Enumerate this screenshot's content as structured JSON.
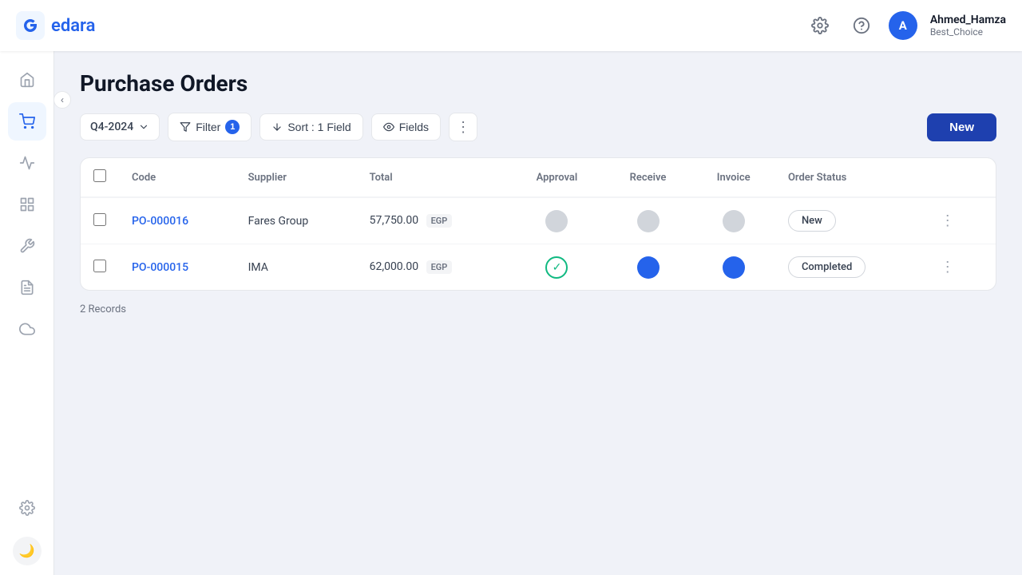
{
  "app": {
    "logo_text": "edara",
    "title": "Purchase Orders"
  },
  "header": {
    "settings_icon": "⚙",
    "help_icon": "?",
    "user_avatar_letter": "A",
    "user_name": "Ahmed_Hamza",
    "user_sub": "Best_Choice"
  },
  "sidebar": {
    "items": [
      {
        "id": "home",
        "icon": "⌂",
        "label": "Home",
        "active": false
      },
      {
        "id": "cart",
        "icon": "🛒",
        "label": "Purchase",
        "active": true
      },
      {
        "id": "chart",
        "icon": "📈",
        "label": "Analytics",
        "active": false
      },
      {
        "id": "grid",
        "icon": "▦",
        "label": "Grid",
        "active": false
      },
      {
        "id": "tools",
        "icon": "🔧",
        "label": "Tools",
        "active": false
      },
      {
        "id": "reports",
        "icon": "📋",
        "label": "Reports",
        "active": false
      },
      {
        "id": "cloud",
        "icon": "☁",
        "label": "Cloud",
        "active": false
      }
    ],
    "bottom_items": [
      {
        "id": "settings",
        "icon": "⚙",
        "label": "Settings"
      }
    ]
  },
  "toolbar": {
    "quarter_label": "Q4-2024",
    "filter_label": "Filter",
    "filter_count": "1",
    "sort_label": "Sort : 1 Field",
    "fields_label": "Fields",
    "new_label": "New"
  },
  "table": {
    "columns": [
      "",
      "Code",
      "Supplier",
      "Total",
      "Approval",
      "Receive",
      "Invoice",
      "Order Status",
      ""
    ],
    "rows": [
      {
        "code": "PO-000016",
        "supplier": "Fares Group",
        "total": "57,750.00",
        "currency": "EGP",
        "approval": "grey",
        "receive": "grey",
        "invoice": "grey",
        "order_status": "New"
      },
      {
        "code": "PO-000015",
        "supplier": "IMA",
        "total": "62,000.00",
        "currency": "EGP",
        "approval": "check",
        "receive": "blue",
        "invoice": "blue",
        "order_status": "Completed"
      }
    ]
  },
  "footer": {
    "records_label": "2 Records"
  },
  "dark_toggle_icon": "🌙"
}
